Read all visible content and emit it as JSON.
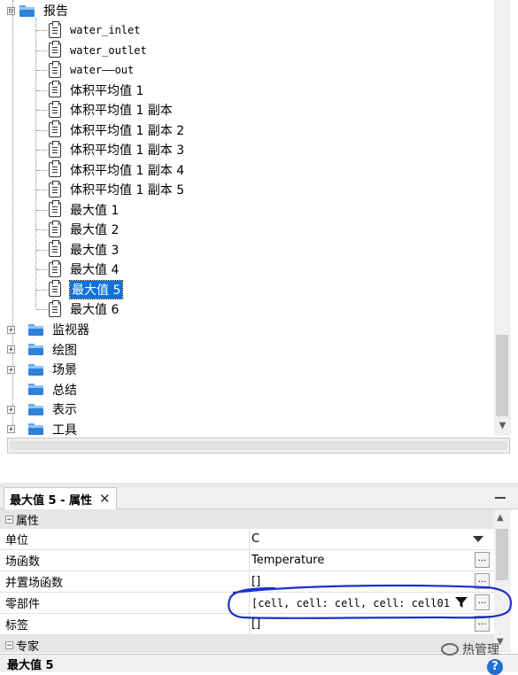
{
  "tree": {
    "report": {
      "label": "报告",
      "expander": "⊟"
    },
    "report_items": [
      {
        "label": "water_inlet",
        "mono": true
      },
      {
        "label": "water_outlet",
        "mono": true
      },
      {
        "label": "water——out",
        "mono": true
      },
      {
        "label": "体积平均值 1"
      },
      {
        "label": "体积平均值 1 副本"
      },
      {
        "label": "体积平均值 1 副本 2"
      },
      {
        "label": "体积平均值 1 副本 3"
      },
      {
        "label": "体积平均值 1 副本 4"
      },
      {
        "label": "体积平均值 1 副本 5"
      },
      {
        "label": "最大值 1"
      },
      {
        "label": "最大值 2"
      },
      {
        "label": "最大值 3"
      },
      {
        "label": "最大值 4"
      },
      {
        "label": "最大值 5",
        "selected": true
      },
      {
        "label": "最大值 6"
      }
    ],
    "folders": [
      {
        "label": "监视器",
        "expander": "+"
      },
      {
        "label": "绘图",
        "expander": "+"
      },
      {
        "label": "场景",
        "expander": "+"
      },
      {
        "label": "总结",
        "expander": ""
      },
      {
        "label": "表示",
        "expander": "+"
      },
      {
        "label": "工具",
        "expander": "+"
      }
    ]
  },
  "properties": {
    "tab_title": "最大值 5 - 属性",
    "tab_close": "✕",
    "category_properties": "属性",
    "category_expert": "专家",
    "rows": [
      {
        "name": "单位",
        "value": "C"
      },
      {
        "name": "场函数",
        "value": "Temperature"
      },
      {
        "name": "并置场函数",
        "value": "[]"
      },
      {
        "name": "零部件",
        "value": "[cell, cell: cell, cell: cell01"
      },
      {
        "name": "标签",
        "value": "[]"
      }
    ],
    "button_label": "..."
  },
  "status": {
    "title": "最大值 5",
    "help": "?"
  },
  "watermark": "热管理",
  "colors": {
    "selection": "#0f72d6",
    "folder": "#2f80d8",
    "annotation": "#1a2fd0"
  }
}
